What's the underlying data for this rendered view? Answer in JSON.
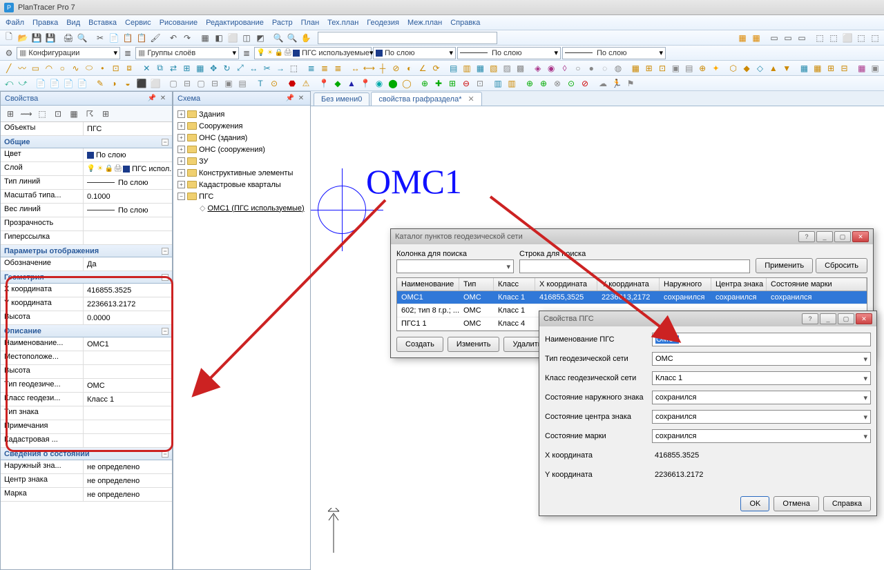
{
  "app": {
    "title": "PlanTracer Pro 7"
  },
  "menu": [
    "Файл",
    "Правка",
    "Вид",
    "Вставка",
    "Сервис",
    "Рисование",
    "Редактирование",
    "Растр",
    "План",
    "Тех.план",
    "Геодезия",
    "Меж.план",
    "Справка"
  ],
  "configs": {
    "config_label": "Конфигурации",
    "layers_label": "Группы слоёв",
    "pgs_label": "ПГС используемые",
    "by_layer": "По слою"
  },
  "panels": {
    "props_title": "Свойства",
    "scheme_title": "Схема"
  },
  "props": {
    "objects_label": "Объекты",
    "objects_value": "ПГС",
    "sections": {
      "general": "Общие",
      "display": "Параметры отображения",
      "geometry": "Геометрия",
      "description": "Описание",
      "status": "Сведения о состоянии"
    },
    "rows": {
      "color_l": "Цвет",
      "color_v": "По слою",
      "layer_l": "Слой",
      "layer_v": "ПГС испол...",
      "linetype_l": "Тип линий",
      "linetype_v": "По слою",
      "linescale_l": "Масштаб типа...",
      "linescale_v": "0.1000",
      "lineweight_l": "Вес линий",
      "lineweight_v": "По слою",
      "transparency_l": "Прозрачность",
      "hyperlink_l": "Гиперссылка",
      "designation_l": "Обозначение",
      "designation_v": "Да",
      "xcoord_l": "X координата",
      "xcoord_v": "416855.3525",
      "ycoord_l": "Y координата",
      "ycoord_v": "2236613.2172",
      "height_l": "Высота",
      "height_v": "0.0000",
      "name_l": "Наименование...",
      "name_v": "ОМС1",
      "location_l": "Местоположе...",
      "height2_l": "Высота",
      "geo_type_l": "Тип геодезиче...",
      "geo_type_v": "ОМС",
      "geo_class_l": "Класс геодези...",
      "geo_class_v": "Класс 1",
      "sign_type_l": "Тип знака",
      "notes_l": "Примечания",
      "cadastral_l": "Кадастровая ...",
      "outer_l": "Наружный зна...",
      "outer_v": "не определено",
      "center_l": "Центр знака",
      "center_v": "не определено",
      "mark_l": "Марка",
      "mark_v": "не определено"
    }
  },
  "tree": [
    {
      "label": "Здания",
      "level": 1,
      "expand": "+",
      "folder": true
    },
    {
      "label": "Сооружения",
      "level": 1,
      "expand": "+",
      "folder": true
    },
    {
      "label": "ОНС (здания)",
      "level": 1,
      "expand": "+",
      "folder": true
    },
    {
      "label": "ОНС (сооружения)",
      "level": 1,
      "expand": "+",
      "folder": true
    },
    {
      "label": "ЗУ",
      "level": 1,
      "expand": "+",
      "folder": true
    },
    {
      "label": "Конструктивные элементы",
      "level": 1,
      "expand": "+",
      "folder": true
    },
    {
      "label": "Кадастровые кварталы",
      "level": 1,
      "expand": "+",
      "folder": true
    },
    {
      "label": "ПГС",
      "level": 1,
      "expand": "−",
      "folder": true
    },
    {
      "label": "ОМС1 (ПГС используемые)",
      "level": 2,
      "expand": "",
      "folder": false,
      "underline": true
    }
  ],
  "tabs": [
    {
      "label": "Без имени0",
      "active": false
    },
    {
      "label": "свойства графраздела*",
      "active": true
    }
  ],
  "canvas": {
    "omc_text": "ОМС1"
  },
  "catalog": {
    "title": "Каталог пунктов геодезической сети",
    "search_col_l": "Колонка для поиска",
    "search_str_l": "Строка для поиска",
    "apply_btn": "Применить",
    "reset_btn": "Сбросить",
    "cols": [
      "Наименование",
      "Тип",
      "Класс",
      "X координата",
      "Y координата",
      "Наружного",
      "Центра знака",
      "Состояние марки"
    ],
    "rows": [
      {
        "c": [
          "ОМС1",
          "ОМС",
          "Класс 1",
          "416855,3525",
          "2236613,2172",
          "сохранился",
          "сохранился",
          "сохранился"
        ],
        "sel": true
      },
      {
        "c": [
          "602; тип 8 г.р.; ...",
          "ОМС",
          "Класс 1",
          "",
          "",
          "",
          "",
          ""
        ],
        "sel": false
      },
      {
        "c": [
          "ПГС1 1",
          "ОМС",
          "Класс 4",
          "",
          "",
          "",
          "",
          ""
        ],
        "sel": false
      }
    ],
    "create_btn": "Создать",
    "edit_btn": "Изменить",
    "delete_btn": "Удалить"
  },
  "pgs_dialog": {
    "title": "Свойства ПГС",
    "rows": [
      {
        "l": "Наименование ПГС",
        "v": "ОМС1",
        "type": "input",
        "sel": true
      },
      {
        "l": "Тип геодезической сети",
        "v": "ОМС",
        "type": "combo"
      },
      {
        "l": "Класс геодезической сети",
        "v": "Класс 1",
        "type": "combo"
      },
      {
        "l": "Состояние наружного знака",
        "v": "сохранился",
        "type": "combo"
      },
      {
        "l": "Состояние центра знака",
        "v": "сохранился",
        "type": "combo"
      },
      {
        "l": "Состояние марки",
        "v": "сохранился",
        "type": "combo"
      },
      {
        "l": "X координата",
        "v": "416855.3525",
        "type": "text"
      },
      {
        "l": "Y координата",
        "v": "2236613.2172",
        "type": "text"
      }
    ],
    "ok": "OK",
    "cancel": "Отмена",
    "help": "Справка"
  }
}
